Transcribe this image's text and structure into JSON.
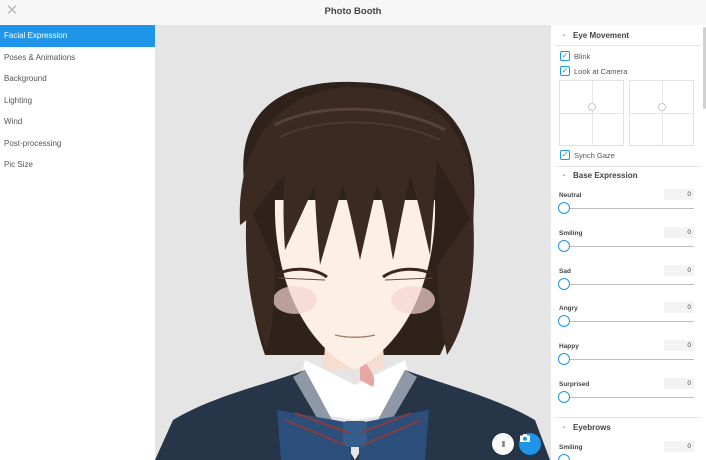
{
  "window": {
    "title": "Photo Booth",
    "close_glyph": "✕"
  },
  "menu": {
    "items": [
      {
        "label": "Facial Expression",
        "active": true
      },
      {
        "label": "Poses & Animations"
      },
      {
        "label": "Background"
      },
      {
        "label": "Lighting"
      },
      {
        "label": "Wind"
      },
      {
        "label": "Post-processing"
      },
      {
        "label": "Pic Size"
      }
    ]
  },
  "viewport": {
    "pause_glyph": "II",
    "colors": {
      "background": "#e5e5e5",
      "hair": "#3a2a22",
      "skin": "#fcefe6",
      "jacket": "#263548",
      "tie": "#2b4f7a"
    }
  },
  "panel": {
    "eye_movement": {
      "title": "Eye Movement",
      "blink": {
        "label": "Blink",
        "checked": true
      },
      "look_at_camera": {
        "label": "Look at Camera",
        "checked": true
      },
      "synch_gaze": {
        "label": "Synch Gaze",
        "checked": true
      }
    },
    "base_expression": {
      "title": "Base Expression",
      "sliders": [
        {
          "label": "Neutral",
          "value": "0"
        },
        {
          "label": "Smiling",
          "value": "0"
        },
        {
          "label": "Sad",
          "value": "0"
        },
        {
          "label": "Angry",
          "value": "0"
        },
        {
          "label": "Happy",
          "value": "0"
        },
        {
          "label": "Surprised",
          "value": "0"
        }
      ]
    },
    "eyebrows": {
      "title": "Eyebrows",
      "sliders": [
        {
          "label": "Smiling",
          "value": "0"
        }
      ]
    }
  },
  "accent_color": "#1e95e8",
  "check_glyph": "✓",
  "chevron_glyph": "⌄"
}
